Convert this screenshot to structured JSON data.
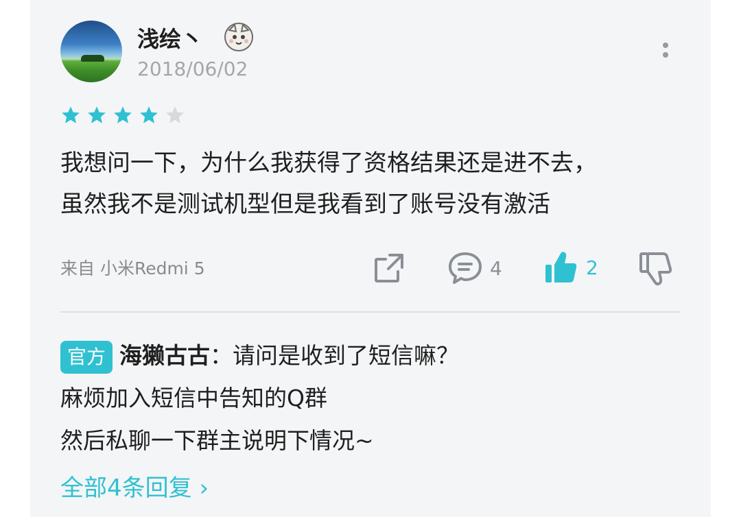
{
  "review": {
    "username": "浅绘丶",
    "date": "2018/06/02",
    "rating": 4,
    "rating_max": 5,
    "content_lines": [
      "我想问一下，为什么我获得了资格结果还是进不去，",
      "虽然我不是测试机型但是我看到了账号没有激活"
    ],
    "device": "来自 小米Redmi 5",
    "comment_count": "4",
    "like_count": "2"
  },
  "reply": {
    "tag": "官方",
    "replier": "海獭古古",
    "separator": "：",
    "lines": [
      "请问是收到了短信嘛？",
      "麻烦加入短信中告知的Q群",
      "然后私聊一下群主说明下情况~"
    ],
    "view_all": "全部4条回复 ›"
  },
  "colors": {
    "accent": "#2fc1d1",
    "star_empty": "#d6dade",
    "icon_gray": "#8a8f96"
  },
  "icons": [
    "share-icon",
    "comment-icon",
    "thumbs-up-icon",
    "thumbs-down-icon",
    "more-icon",
    "badge-icon"
  ]
}
